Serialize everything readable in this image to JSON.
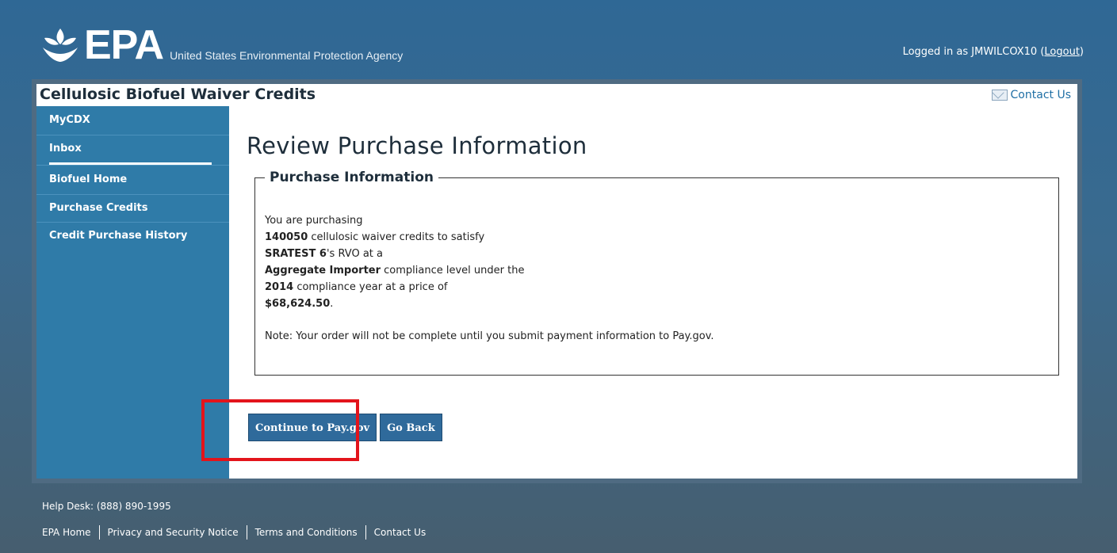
{
  "header": {
    "logo_text": "EPA",
    "agency_name": "United States Environmental Protection Agency",
    "logged_in_prefix": "Logged in as JMWILCOX10",
    "logout_label": "Logout"
  },
  "app": {
    "title": "Cellulosic Biofuel Waiver Credits",
    "contact_us": "Contact Us"
  },
  "sidebar": {
    "items": [
      {
        "label": "MyCDX"
      },
      {
        "label": "Inbox"
      },
      {
        "label": "Biofuel Home"
      },
      {
        "label": "Purchase Credits"
      },
      {
        "label": "Credit Purchase History"
      }
    ]
  },
  "main": {
    "page_title": "Review Purchase Information",
    "fieldset_legend": "Purchase Information",
    "line1": "You are purchasing",
    "credits": "140050",
    "line2_suffix": " cellulosic waiver credits to satisfy",
    "company": "SRATEST 6",
    "line3_suffix": "'s RVO at a",
    "compliance_level": "Aggregate Importer",
    "line4_suffix": " compliance level under the",
    "year": "2014",
    "line5_suffix": " compliance year at a price of",
    "price": "$68,624.50",
    "price_suffix": ".",
    "note": "Note: Your order will not be complete until you submit payment information to Pay.gov."
  },
  "buttons": {
    "continue": "Continue to Pay.gov",
    "back": "Go Back"
  },
  "footer": {
    "help_desk": "Help Desk: (888) 890-1995",
    "links": [
      "EPA Home",
      "Privacy and Security Notice",
      "Terms and Conditions",
      "Contact Us"
    ]
  },
  "colors": {
    "highlight": "#e3141b",
    "sidebar": "#2f7ba8",
    "button": "#2f6a9b"
  }
}
